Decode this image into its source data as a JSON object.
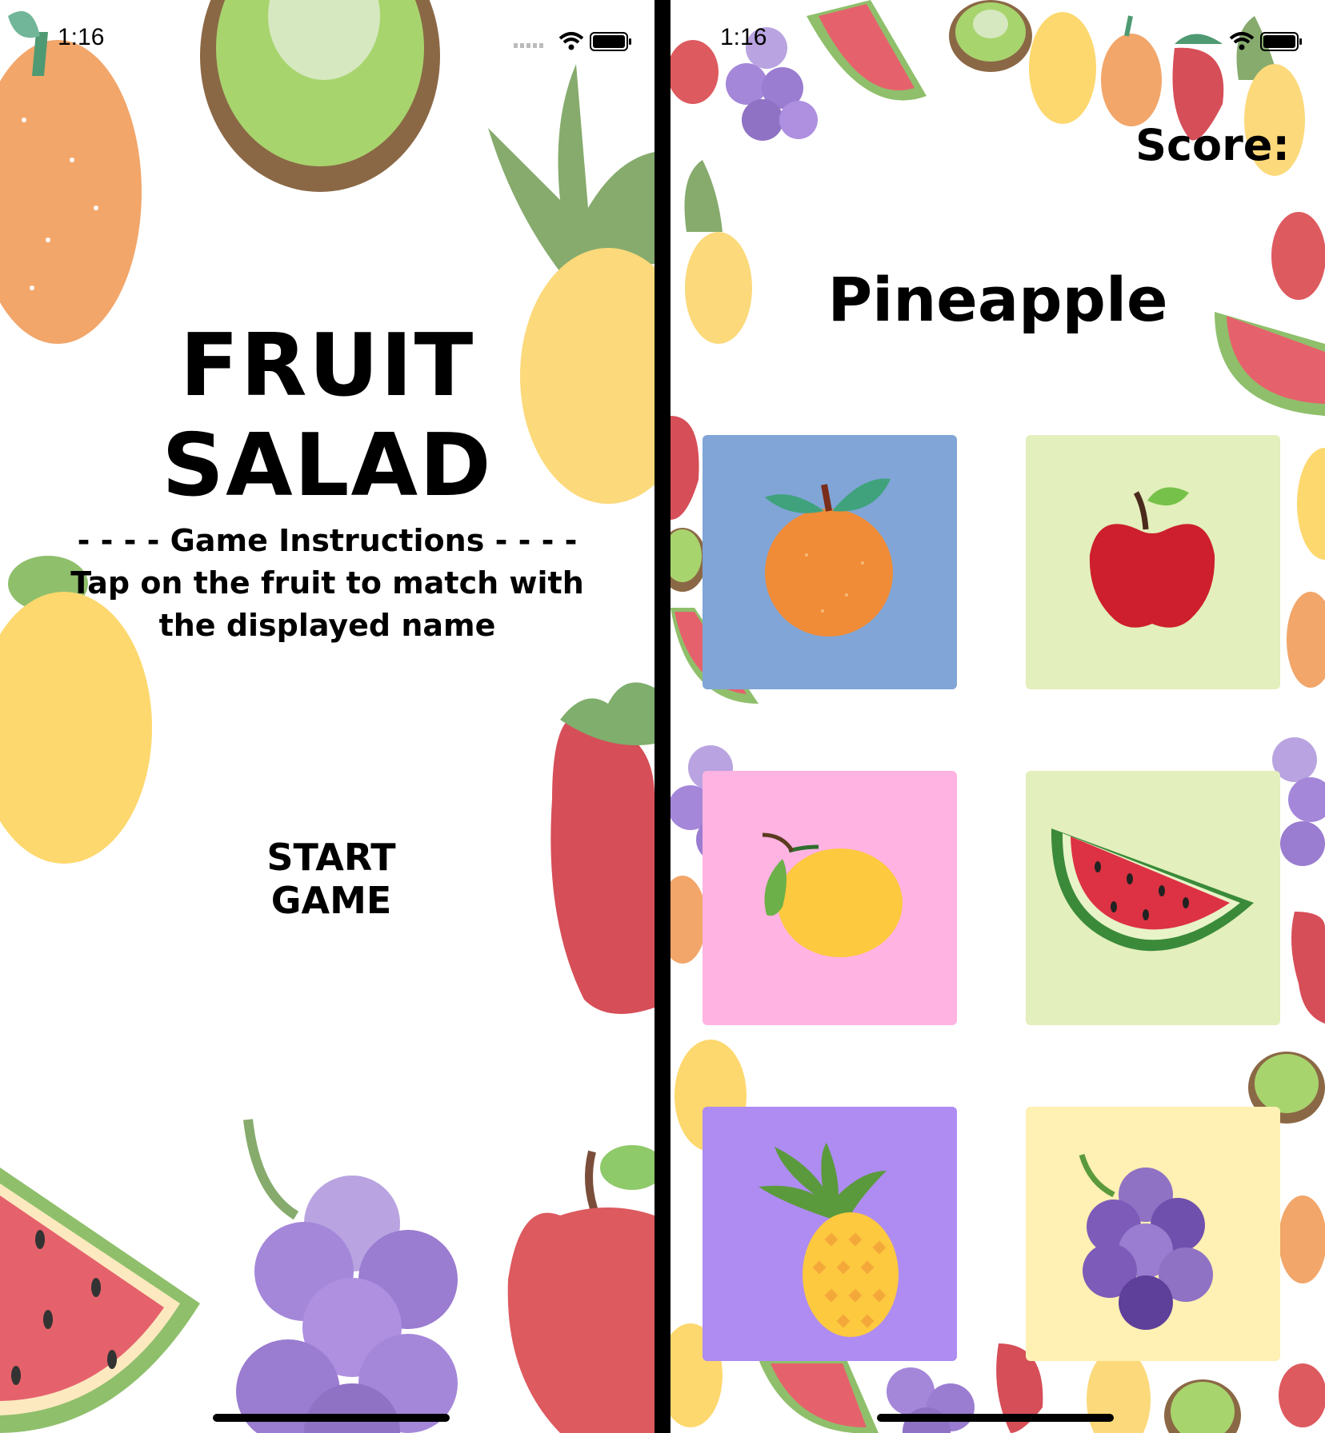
{
  "status_bar": {
    "time": "1:16"
  },
  "start_screen": {
    "title": "FRUIT SALAD",
    "instructions_heading": "- - - - Game Instructions - - - -",
    "instructions_line1": "Tap on the fruit to match with",
    "instructions_line2": "the displayed name",
    "start_button": "START GAME"
  },
  "game_screen": {
    "score_label": "Score:",
    "target_fruit": "Pineapple",
    "tiles": [
      {
        "fruit": "orange-icon",
        "bg": "#80a5d6"
      },
      {
        "fruit": "apple-icon",
        "bg": "#e3efbc"
      },
      {
        "fruit": "lemon-icon",
        "bg": "#ffb3e2"
      },
      {
        "fruit": "watermelon-icon",
        "bg": "#e3efbc"
      },
      {
        "fruit": "pineapple-icon",
        "bg": "#ae8cf2"
      },
      {
        "fruit": "grapes-icon",
        "bg": "#fff0b3"
      }
    ]
  }
}
